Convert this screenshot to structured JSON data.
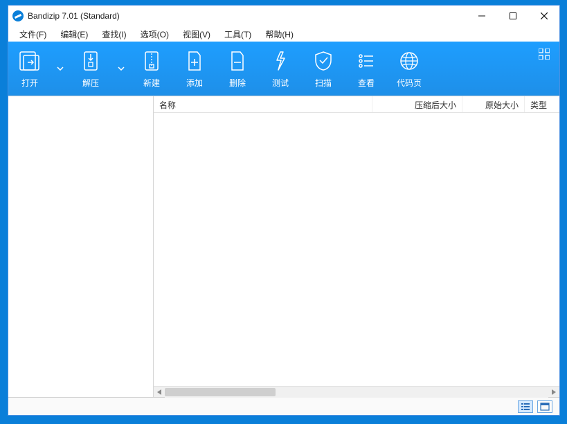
{
  "title": "Bandizip 7.01 (Standard)",
  "menu": {
    "file": "文件(F)",
    "edit": "编辑(E)",
    "find": "查找(I)",
    "options": "选项(O)",
    "view": "视图(V)",
    "tools": "工具(T)",
    "help": "帮助(H)"
  },
  "toolbar": {
    "open": "打开",
    "extract": "解压",
    "new": "新建",
    "add": "添加",
    "delete": "删除",
    "test": "测试",
    "scan": "扫描",
    "view": "查看",
    "codepage": "代码页"
  },
  "columns": {
    "name": "名称",
    "compressed": "压缩后大小",
    "original": "原始大小",
    "type": "类型"
  }
}
